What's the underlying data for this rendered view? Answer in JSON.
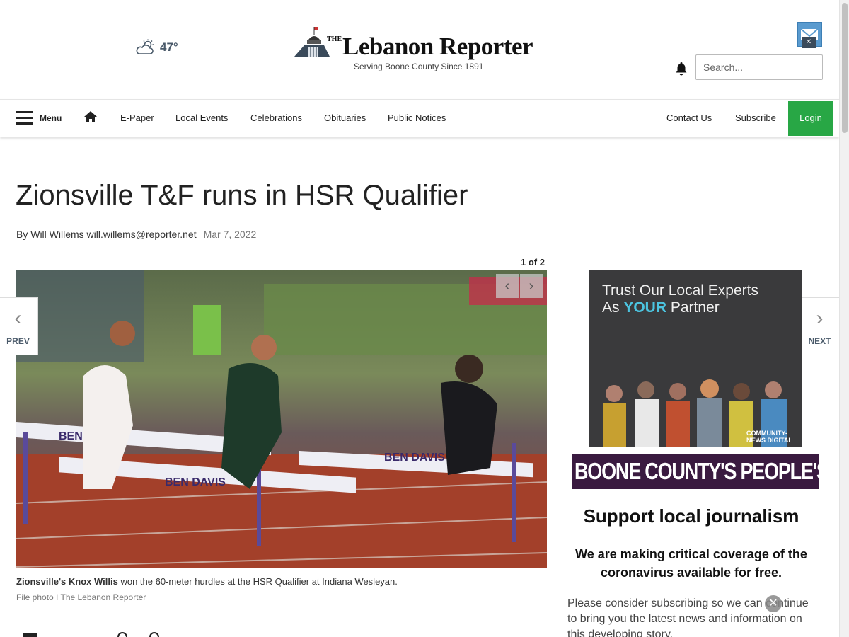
{
  "header": {
    "weather": {
      "icon": "partly-cloudy-icon",
      "temperature": "47°"
    },
    "logo": {
      "the": "THE",
      "name": "Lebanon Reporter",
      "tagline": "Serving Boone County Since 1891"
    },
    "search": {
      "placeholder": "Search..."
    },
    "notification_icon": "bell-icon"
  },
  "nav": {
    "menu_label": "Menu",
    "items": [
      "E-Paper",
      "Local Events",
      "Celebrations",
      "Obituaries",
      "Public Notices"
    ],
    "right_items": [
      "Contact Us",
      "Subscribe"
    ],
    "login_label": "Login",
    "login_color": "#28a745"
  },
  "article": {
    "headline": "Zionsville T&F runs in HSR Qualifier",
    "byline": {
      "prefix": "By Will Willems will.willems@reporter.net",
      "date": "Mar 7, 2022"
    },
    "photo_count": "1 of 2",
    "caption": {
      "name": "Zionsville's Knox Willis",
      "text": " won the 60-meter hurdles at the HSR Qualifier at Indiana Wesleyan."
    },
    "credit": "File photo I The Lebanon Reporter",
    "prev_label": "PREV",
    "next_label": "NEXT"
  },
  "sidebar": {
    "ad1": {
      "line1": "Trust Our Local Experts",
      "line2_pre": "As ",
      "line2_hl": "YOUR",
      "line2_post": " Partner",
      "brand": "COMMUNITY-NEWS DIGITAL"
    },
    "ad2": {
      "text": "BOONE COUNTY'S PEOPLE'S CHOICE!"
    },
    "support": {
      "title": "Support local journalism",
      "subtitle": "We are making critical coverage of the coronavirus available for free.",
      "body": "Please consider subscribing so we can continue to bring you the latest news and information on this developing story."
    }
  }
}
